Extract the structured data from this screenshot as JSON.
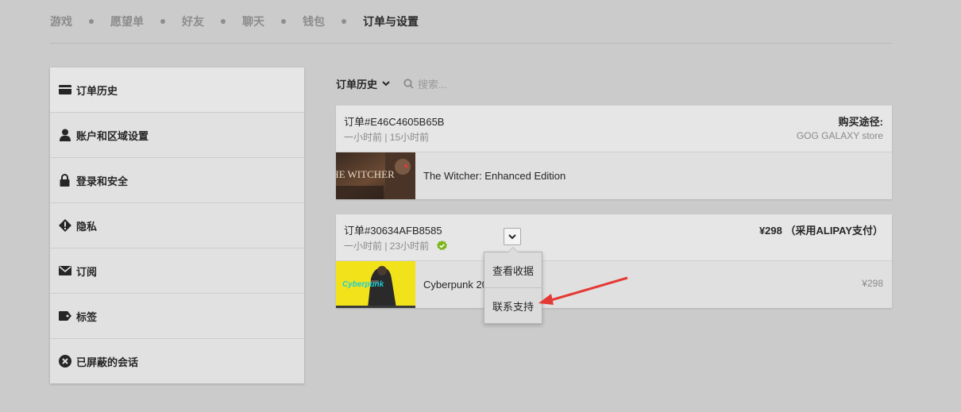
{
  "nav": {
    "items": [
      {
        "label": "游戏"
      },
      {
        "label": "愿望单"
      },
      {
        "label": "好友"
      },
      {
        "label": "聊天"
      },
      {
        "label": "钱包"
      },
      {
        "label": "订单与设置",
        "active": true
      }
    ]
  },
  "sidebar": {
    "items": [
      {
        "label": "订单历史",
        "icon": "card-icon"
      },
      {
        "label": "账户和区域设置",
        "icon": "user-icon"
      },
      {
        "label": "登录和安全",
        "icon": "lock-icon"
      },
      {
        "label": "隐私",
        "icon": "privacy-icon"
      },
      {
        "label": "订阅",
        "icon": "mail-icon"
      },
      {
        "label": "标签",
        "icon": "tag-icon"
      },
      {
        "label": "已屏蔽的会话",
        "icon": "blocked-icon"
      }
    ]
  },
  "filter": {
    "title": "订单历史",
    "search_placeholder": "搜索..."
  },
  "orders": [
    {
      "id": "订单#E46C4605B65B",
      "time": "一小时前 | 15小时前",
      "right_label": "购买途径:",
      "right_sub": "GOG GALAXY store",
      "game": "The Witcher: Enhanced Edition",
      "thumb_text": "THE WITCHER"
    },
    {
      "id": "订单#30634AFB8585",
      "time": "一小时前 | 23小时前",
      "right_label": "¥298 （采用ALIPAY支付）",
      "game": "Cyberpunk 2077",
      "price": "¥298",
      "thumb_text": "Cyberpunk"
    }
  ],
  "dropdown": {
    "items": [
      "查看收据",
      "联系支持"
    ]
  },
  "colors": {
    "background": "#cbcbcb",
    "card": "#e0e0e0",
    "check": "#7cb518",
    "arrow": "#e53935"
  }
}
